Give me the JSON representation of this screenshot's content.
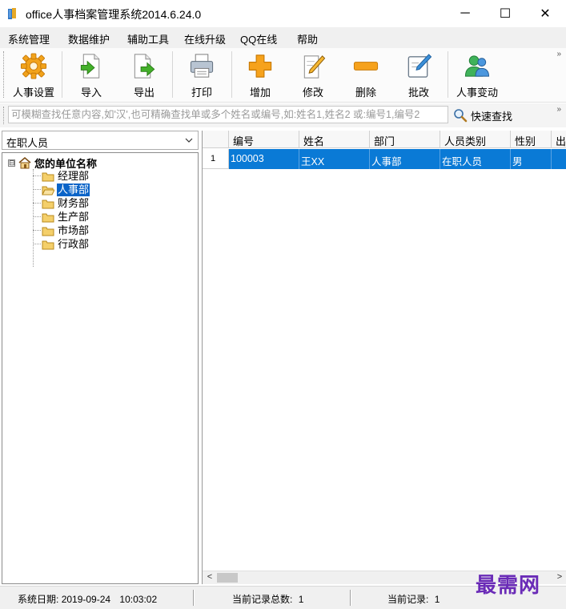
{
  "window": {
    "title": "office人事档案管理系统2014.6.24.0",
    "minimize_glyph": "─",
    "maximize_glyph": "☐",
    "close_glyph": "✕"
  },
  "menu": {
    "items": [
      {
        "label": "系统管理"
      },
      {
        "label": "数据维护"
      },
      {
        "label": "辅助工具"
      },
      {
        "label": "在线升级"
      },
      {
        "label": "QQ在线"
      },
      {
        "label": "帮助"
      }
    ]
  },
  "toolbar": {
    "buttons": [
      {
        "label": "人事设置",
        "icon": "gear-icon"
      },
      {
        "label": "导入",
        "icon": "import-icon"
      },
      {
        "label": "导出",
        "icon": "export-icon"
      },
      {
        "label": "打印",
        "icon": "printer-icon"
      },
      {
        "label": "增加",
        "icon": "plus-icon"
      },
      {
        "label": "修改",
        "icon": "edit-icon"
      },
      {
        "label": "删除",
        "icon": "minus-icon"
      },
      {
        "label": "批改",
        "icon": "batch-edit-icon"
      },
      {
        "label": "人事变动",
        "icon": "users-icon"
      }
    ],
    "more_glyph": "»"
  },
  "search": {
    "placeholder": "可模糊查找任意内容,如'汉',也可精确查找单或多个姓名或编号,如:姓名1,姓名2 或:编号1,编号2",
    "value": "",
    "quick_search_label": "快速查找"
  },
  "filter": {
    "selected": "在职人员"
  },
  "tree": {
    "root_label": "您的单位名称",
    "toggle_glyph": "⊟",
    "children": [
      {
        "label": "经理部",
        "selected": false
      },
      {
        "label": "人事部",
        "selected": true
      },
      {
        "label": "财务部",
        "selected": false
      },
      {
        "label": "生产部",
        "selected": false
      },
      {
        "label": "市场部",
        "selected": false
      },
      {
        "label": "行政部",
        "selected": false
      }
    ]
  },
  "grid": {
    "columns": [
      "编号",
      "姓名",
      "部门",
      "人员类别",
      "性别",
      "出"
    ],
    "rows": [
      {
        "num": "1",
        "cells": [
          "100003",
          "王XX",
          "人事部",
          "在职人员",
          "男",
          ""
        ]
      }
    ],
    "scroll_left_glyph": "<",
    "scroll_right_glyph": ">"
  },
  "status": {
    "date_label": "系统日期:",
    "date_value": "2019-09-24",
    "time_value": "10:03:02",
    "total_label": "当前记录总数:",
    "total_value": "1",
    "current_label": "当前记录:",
    "current_value": "1"
  },
  "watermark": {
    "text": "最需网"
  },
  "colors": {
    "selection": "#0a7ad6",
    "tree_selection": "#0a64c8",
    "watermark": "#6a2bb7"
  }
}
